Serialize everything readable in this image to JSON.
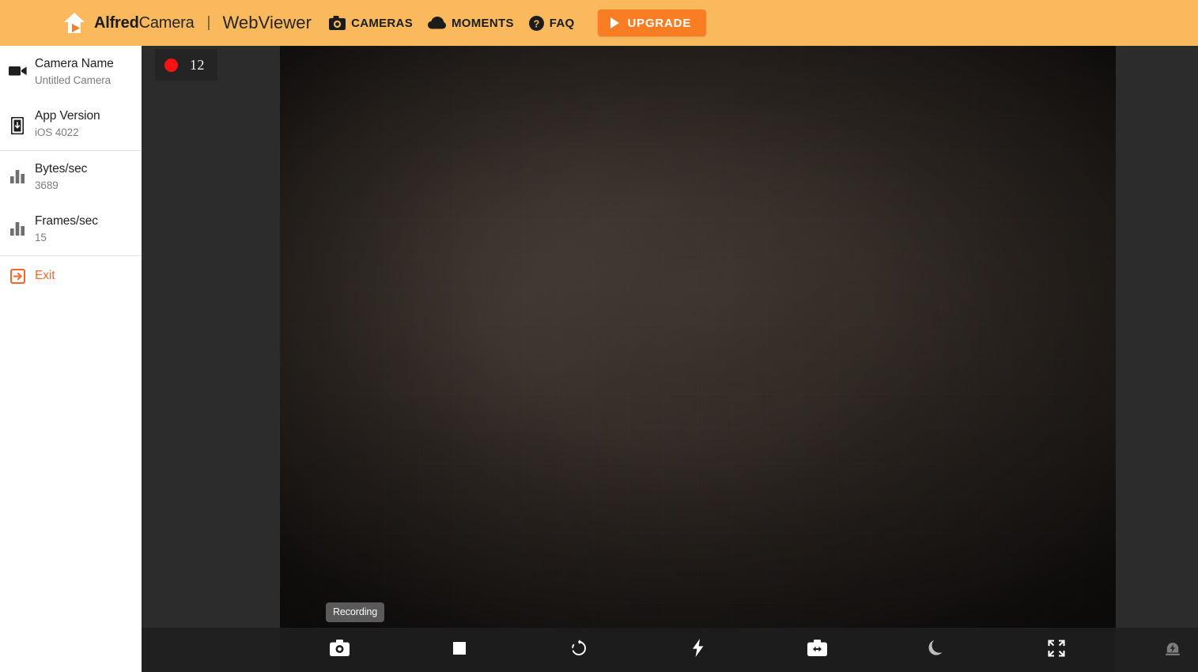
{
  "header": {
    "brand_bold": "Alfred",
    "brand_light": "Camera",
    "divider": "|",
    "product": "WebViewer",
    "logo_icon": "house-play-logo-icon",
    "nav": [
      {
        "label": "CAMERAS",
        "icon": "camera-icon"
      },
      {
        "label": "MOMENTS",
        "icon": "cloud-icon"
      },
      {
        "label": "FAQ",
        "icon": "question-circle-icon"
      }
    ],
    "upgrade": {
      "label": "UPGRADE",
      "icon": "play-triangle-icon"
    },
    "bg_color": "#fbb95e",
    "upgrade_color": "#f97d23"
  },
  "sidebar": {
    "groups": [
      {
        "bordered": false,
        "items": [
          {
            "title": "Camera Name",
            "value": "Untitled Camera",
            "icon": "video-camera-icon",
            "name": "camera-name"
          },
          {
            "title": "App Version",
            "value": "iOS 4022",
            "icon": "phone-download-icon",
            "name": "app-version"
          }
        ]
      },
      {
        "bordered": true,
        "items": [
          {
            "title": "Bytes/sec",
            "value": "3689",
            "icon": "bar-chart-icon",
            "name": "bytes-per-sec"
          },
          {
            "title": "Frames/sec",
            "value": "15",
            "icon": "bar-chart-icon",
            "name": "frames-per-sec"
          }
        ]
      }
    ],
    "exit": {
      "label": "Exit",
      "icon": "exit-arrow-icon",
      "color": "#f4662a"
    }
  },
  "stage": {
    "recording_badge": {
      "count": "12",
      "dot_color": "#fb1212",
      "icon": "record-dot-icon"
    },
    "tooltip": "Recording"
  },
  "toolbar": {
    "buttons": [
      {
        "label": "Snapshot",
        "icon": "camera-shutter-icon",
        "name": "snapshot-button"
      },
      {
        "label": "Stop",
        "icon": "stop-square-icon",
        "name": "stop-recording-button"
      },
      {
        "label": "Rotate",
        "icon": "rotate-icon",
        "name": "rotate-button"
      },
      {
        "label": "Flash",
        "icon": "flash-bolt-icon",
        "name": "flash-button"
      },
      {
        "label": "Switch Camera",
        "icon": "camera-flip-icon",
        "name": "switch-camera-button"
      },
      {
        "label": "Night Mode",
        "icon": "moon-icon",
        "name": "night-mode-button"
      },
      {
        "label": "Fullscreen",
        "icon": "fullscreen-expand-icon",
        "name": "fullscreen-button"
      }
    ],
    "siren": {
      "label": "Siren",
      "icon": "siren-icon",
      "name": "siren-button"
    }
  }
}
